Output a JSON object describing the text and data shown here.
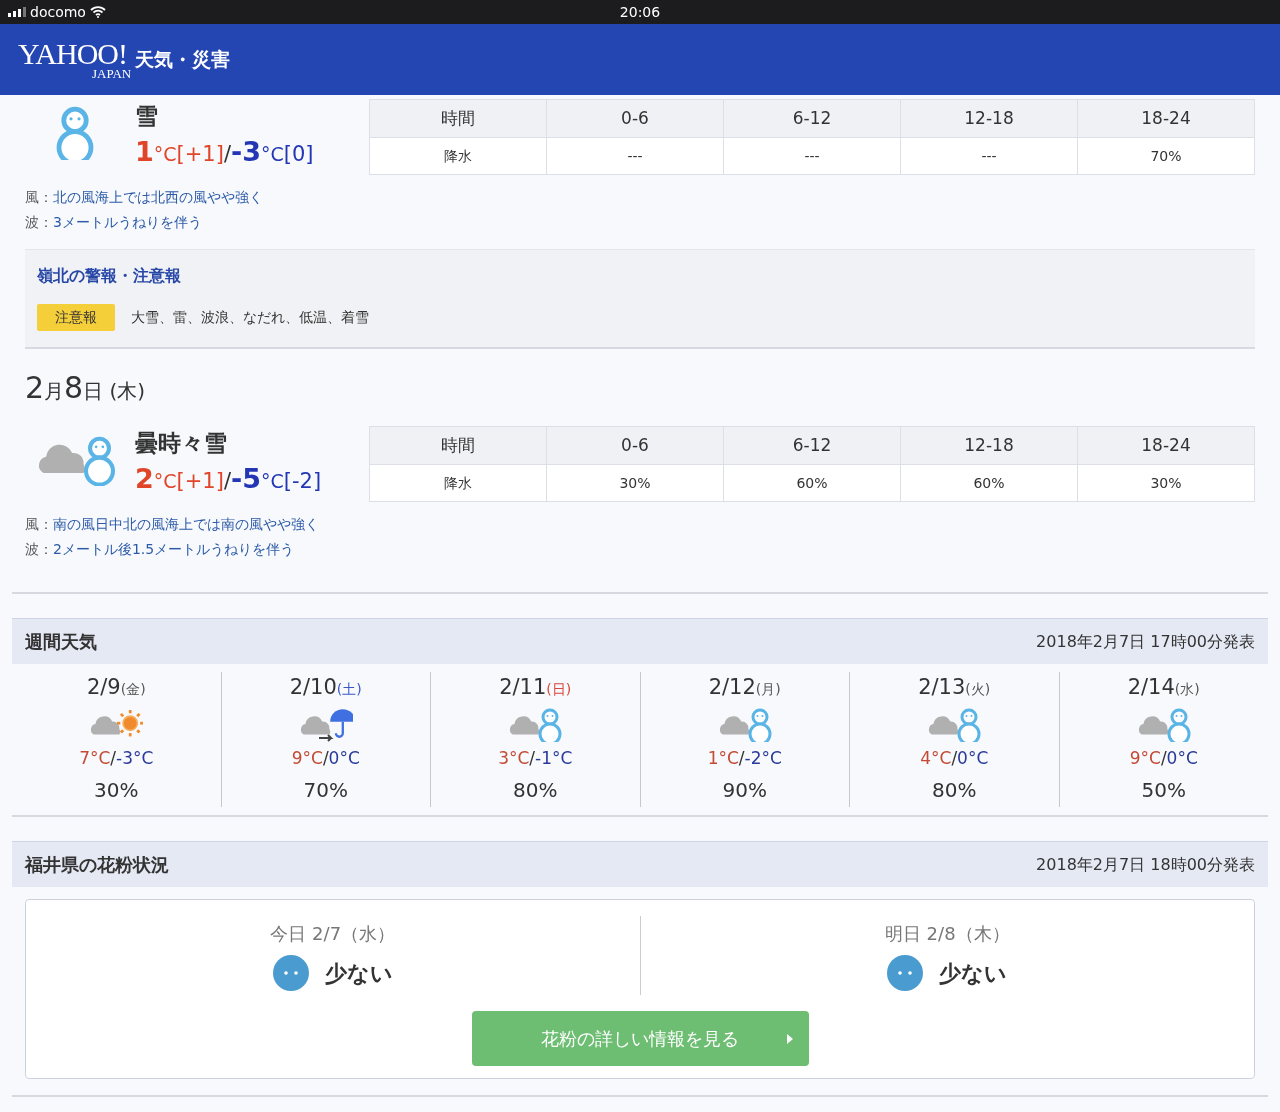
{
  "status_bar": {
    "carrier": "docomo",
    "time": "20:06"
  },
  "header": {
    "logo": "YAHOO!",
    "logo_sub": "JAPAN",
    "service": "天気・災害"
  },
  "days": [
    {
      "kind": "snow",
      "weather": "雪",
      "high": "1",
      "high_unit": "°C",
      "high_diff": "[+1]",
      "separator": "/",
      "low": "-3",
      "low_unit": "°C",
      "low_diff": "[0]",
      "precip": {
        "header_label": "時間",
        "periods": [
          "0-6",
          "6-12",
          "12-18",
          "18-24"
        ],
        "row_label": "降水",
        "values": [
          "---",
          "---",
          "---",
          "70%"
        ]
      },
      "wind_label": "風：",
      "wind": "北の風海上では北西の風やや強く",
      "wave_label": "波：",
      "wave": "3メートルうねりを伴う",
      "warnings": {
        "title": "嶺北の警報・注意報",
        "badge": "注意報",
        "text": "大雪、雷、波浪、なだれ、低温、着雪"
      }
    },
    {
      "date_parts": [
        {
          "text": "2",
          "kind": "num"
        },
        {
          "text": "月",
          "kind": "unit"
        },
        {
          "text": "8",
          "kind": "num"
        },
        {
          "text": "日",
          "kind": "unit"
        },
        {
          "text": " (木)",
          "kind": "weekday"
        }
      ],
      "kind": "cloud_snow",
      "weather": "曇時々雪",
      "high": "2",
      "high_unit": "°C",
      "high_diff": "[+1]",
      "separator": "/",
      "low": "-5",
      "low_unit": "°C",
      "low_diff": "[-2]",
      "precip": {
        "header_label": "時間",
        "periods": [
          "0-6",
          "6-12",
          "12-18",
          "18-24"
        ],
        "row_label": "降水",
        "values": [
          "30%",
          "60%",
          "60%",
          "30%"
        ]
      },
      "wind_label": "風：",
      "wind": "南の風日中北の風海上では南の風やや強く",
      "wave_label": "波：",
      "wave": "2メートル後1.5メートルうねりを伴う"
    }
  ],
  "weekly": {
    "title": "週間天気",
    "published": "2018年2月7日 17時00分発表",
    "days": [
      {
        "date": "2/9",
        "weekday": "(金)",
        "color": "#555555",
        "kind": "cloud_sun",
        "high": "7°C",
        "separator": "/",
        "low": "-3°C",
        "precip": "30%"
      },
      {
        "date": "2/10",
        "weekday": "(土)",
        "color": "#3a57c8",
        "kind": "cloud_then_rain",
        "high": "9°C",
        "separator": "/",
        "low": "0°C",
        "precip": "70%"
      },
      {
        "date": "2/11",
        "weekday": "(日)",
        "color": "#d9473a",
        "kind": "cloud_snow",
        "high": "3°C",
        "separator": "/",
        "low": "-1°C",
        "precip": "80%"
      },
      {
        "date": "2/12",
        "weekday": "(月)",
        "color": "#555555",
        "kind": "cloud_snow",
        "high": "1°C",
        "separator": "/",
        "low": "-2°C",
        "precip": "90%"
      },
      {
        "date": "2/13",
        "weekday": "(火)",
        "color": "#555555",
        "kind": "cloud_snow",
        "high": "4°C",
        "separator": "/",
        "low": "0°C",
        "precip": "80%"
      },
      {
        "date": "2/14",
        "weekday": "(水)",
        "color": "#555555",
        "kind": "cloud_snow",
        "high": "9°C",
        "separator": "/",
        "low": "0°C",
        "precip": "50%"
      }
    ]
  },
  "pollen": {
    "title": "福井県の花粉状況",
    "published": "2018年2月7日 18時00分発表",
    "days": [
      {
        "label": "今日 2/7（水）",
        "level_text": "少ない"
      },
      {
        "label": "明日 2/8（木）",
        "level_text": "少ない"
      }
    ],
    "button": "花粉の詳しい情報を見る"
  }
}
